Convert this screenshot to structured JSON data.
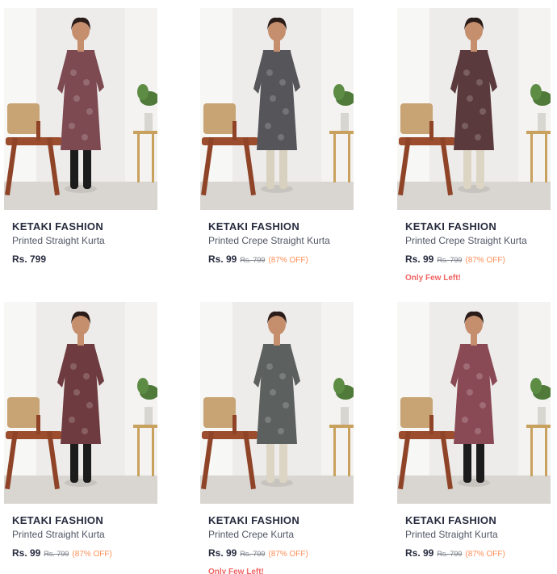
{
  "colors": {
    "brand_text": "#282c3f",
    "discount": "#ff905a",
    "stock_warning": "#f16565"
  },
  "products": [
    {
      "brand": "KETAKI FASHION",
      "title": "Printed Straight Kurta",
      "price": "Rs. 799",
      "mrp": "",
      "discount": "",
      "stock": "",
      "kurta_color": "#7d4a52",
      "pants_color": "#1c1c1c"
    },
    {
      "brand": "KETAKI FASHION",
      "title": "Printed Crepe Straight Kurta",
      "price": "Rs. 99",
      "mrp": "Rs. 799",
      "discount": "(87% OFF)",
      "stock": "",
      "kurta_color": "#55555a",
      "pants_color": "#d8d1bf"
    },
    {
      "brand": "KETAKI FASHION",
      "title": "Printed Crepe Straight Kurta",
      "price": "Rs. 99",
      "mrp": "Rs. 799",
      "discount": "(87% OFF)",
      "stock": "Only Few Left!",
      "kurta_color": "#5a3a3c",
      "pants_color": "#ddd5c3"
    },
    {
      "brand": "KETAKI FASHION",
      "title": "Printed Straight Kurta",
      "price": "Rs. 99",
      "mrp": "Rs. 799",
      "discount": "(87% OFF)",
      "stock": "",
      "kurta_color": "#6e3c40",
      "pants_color": "#1c1c1c"
    },
    {
      "brand": "KETAKI FASHION",
      "title": "Printed Crepe Kurta",
      "price": "Rs. 99",
      "mrp": "Rs. 799",
      "discount": "(87% OFF)",
      "stock": "Only Few Left!",
      "kurta_color": "#5c605e",
      "pants_color": "#ddd5c3"
    },
    {
      "brand": "KETAKI FASHION",
      "title": "Printed Straight Kurta",
      "price": "Rs. 99",
      "mrp": "Rs. 799",
      "discount": "(87% OFF)",
      "stock": "",
      "kurta_color": "#8a4a55",
      "pants_color": "#1c1c1c"
    }
  ]
}
